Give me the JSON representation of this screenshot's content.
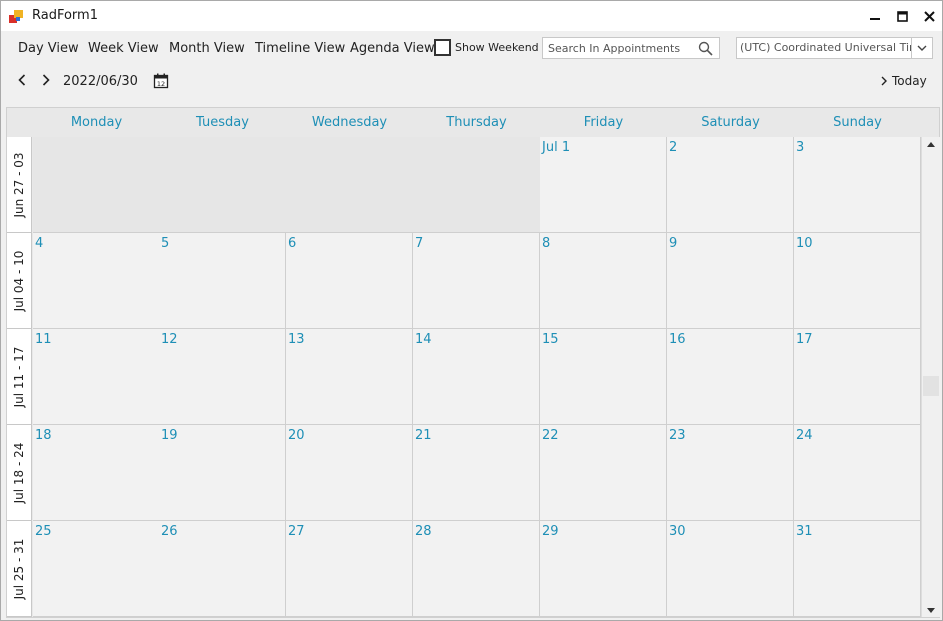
{
  "window": {
    "title": "RadForm1"
  },
  "toolbar": {
    "views": [
      {
        "label": "Day View"
      },
      {
        "label": "Week View"
      },
      {
        "label": "Month View"
      },
      {
        "label": "Timeline View"
      },
      {
        "label": "Agenda View"
      }
    ],
    "show_weekend_label": "Show Weekend",
    "show_weekend_checked": false,
    "search_placeholder": "Search In Appointments",
    "timezone": "(UTC) Coordinated Universal Time"
  },
  "navigation": {
    "date": "2022/06/30",
    "today_label": "Today"
  },
  "calendar": {
    "days": [
      "Monday",
      "Tuesday",
      "Wednesday",
      "Thursday",
      "Friday",
      "Saturday",
      "Sunday"
    ],
    "weeks": [
      {
        "label": "Jun 27 - 03",
        "cells": [
          "",
          "",
          "",
          "",
          "Jul 1",
          "2",
          "3"
        ]
      },
      {
        "label": "Jul 04 - 10",
        "cells": [
          "4",
          "5",
          "6",
          "7",
          "8",
          "9",
          "10"
        ]
      },
      {
        "label": "Jul 11 - 17",
        "cells": [
          "11",
          "12",
          "13",
          "14",
          "15",
          "16",
          "17"
        ]
      },
      {
        "label": "Jul 18 - 24",
        "cells": [
          "18",
          "19",
          "20",
          "21",
          "22",
          "23",
          "24"
        ]
      },
      {
        "label": "Jul 25 - 31",
        "cells": [
          "25",
          "26",
          "27",
          "28",
          "29",
          "30",
          "31"
        ]
      }
    ]
  },
  "colors": {
    "accent": "#1e8fb6",
    "cell": "#f2f2f2",
    "inactive_cell": "#e6e6e6"
  }
}
